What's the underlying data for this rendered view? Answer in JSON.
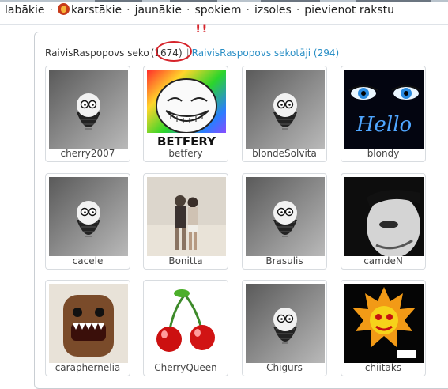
{
  "nav": {
    "items": [
      "labākie",
      "karstākie",
      "jaunākie",
      "spokiem",
      "izsoles",
      "pievienot rakstu"
    ],
    "separator": "·"
  },
  "heading": {
    "following_label": "RaivisRaspopovs seko",
    "following_count": "(1674)",
    "divider": "|",
    "followers_link": "RaivisRaspopovs sekotāji (294)"
  },
  "annotation": {
    "exclaim": "!!"
  },
  "users": [
    {
      "name": "cherry2007",
      "avatar": "default-avatar"
    },
    {
      "name": "betfery",
      "avatar": "trollface-avatar"
    },
    {
      "name": "blondeSolvita",
      "avatar": "default-avatar"
    },
    {
      "name": "blondy",
      "avatar": "blue-eyes-hello-avatar"
    },
    {
      "name": "cacele",
      "avatar": "default-avatar"
    },
    {
      "name": "Bonitta",
      "avatar": "couple-beach-photo"
    },
    {
      "name": "Brasulis",
      "avatar": "default-avatar"
    },
    {
      "name": "camdeN",
      "avatar": "bw-face-photo"
    },
    {
      "name": "caraphernelia",
      "avatar": "brown-monster-toy"
    },
    {
      "name": "CherryQueen",
      "avatar": "cherries-avatar"
    },
    {
      "name": "Chigurs",
      "avatar": "default-avatar"
    },
    {
      "name": "chiitaks",
      "avatar": "fire-clown-avatar"
    }
  ]
}
